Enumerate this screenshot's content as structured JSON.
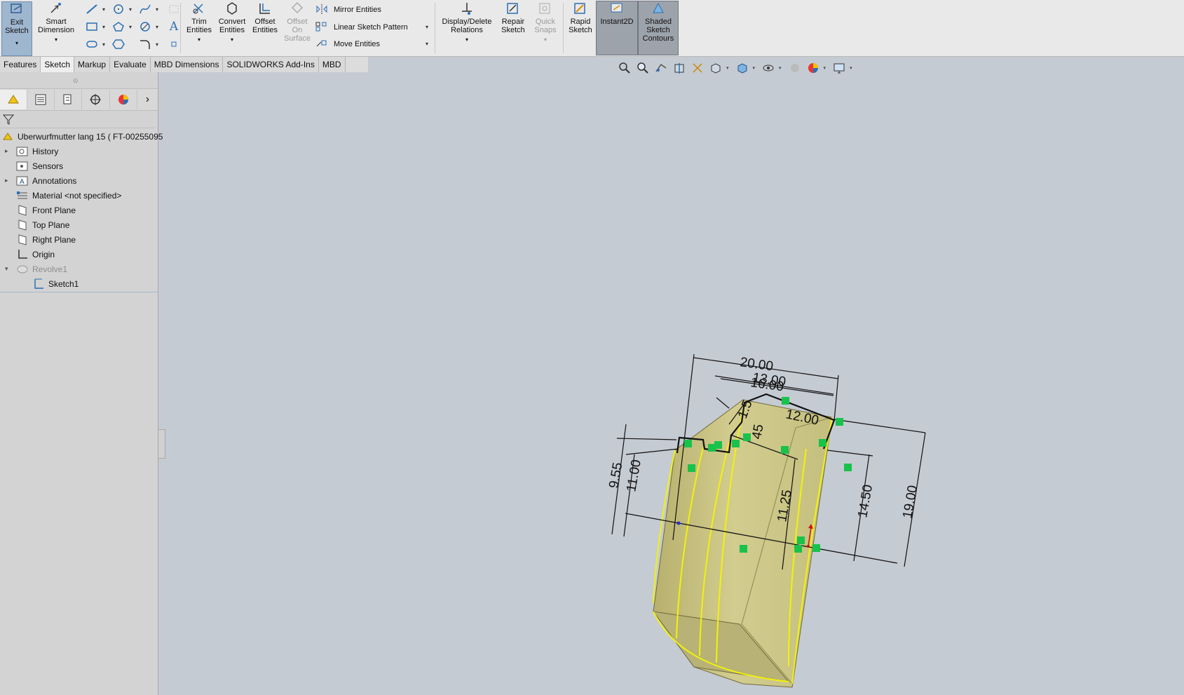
{
  "ribbon": {
    "exit_sketch": "Exit\nSketch",
    "smart_dimension": "Smart\nDimension",
    "trim_entities": "Trim\nEntities",
    "convert_entities": "Convert\nEntities",
    "offset_entities": "Offset\nEntities",
    "offset_on_surface": "Offset\nOn\nSurface",
    "mirror_entities": "Mirror Entities",
    "linear_sketch_pattern": "Linear Sketch Pattern",
    "move_entities": "Move Entities",
    "display_delete_relations": "Display/Delete\nRelations",
    "repair_sketch": "Repair\nSketch",
    "quick_snaps": "Quick\nSnaps",
    "rapid_sketch": "Rapid\nSketch",
    "instant2d": "Instant2D",
    "shaded_sketch_contours": "Shaded\nSketch\nContours"
  },
  "tabs": [
    "Features",
    "Sketch",
    "Markup",
    "Evaluate",
    "MBD Dimensions",
    "SOLIDWORKS Add-Ins",
    "MBD"
  ],
  "active_tab": "Sketch",
  "tree": {
    "root": "Uberwurfmutter lang 15 ( FT-00255095",
    "items": [
      {
        "label": "History",
        "icon": "history-icon"
      },
      {
        "label": "Sensors",
        "icon": "sensors-icon"
      },
      {
        "label": "Annotations",
        "icon": "annotations-icon"
      },
      {
        "label": "Material <not specified>",
        "icon": "material-icon"
      },
      {
        "label": "Front Plane",
        "icon": "plane-icon"
      },
      {
        "label": "Top Plane",
        "icon": "plane-icon"
      },
      {
        "label": "Right Plane",
        "icon": "plane-icon"
      },
      {
        "label": "Origin",
        "icon": "origin-icon"
      },
      {
        "label": "Revolve1",
        "icon": "revolve-icon"
      },
      {
        "label": "Sketch1",
        "icon": "sketch-icon"
      }
    ]
  },
  "dimensions": {
    "d1": "20.00",
    "d2": "13.00",
    "d3": "16.00",
    "d4": "12.00",
    "d5": "1.5",
    "d6": "45",
    "d7": "9.55",
    "d8": "11.00",
    "d9": "11.25",
    "d10": "14.50",
    "d11": "19.00"
  },
  "colors": {
    "ribbon_bg": "#e9e9e9",
    "viewport_bg": "#c5cbd3",
    "model_fill": "#c9c384",
    "edge_highlight": "#f2f20a",
    "relation_marker": "#19c24a"
  }
}
